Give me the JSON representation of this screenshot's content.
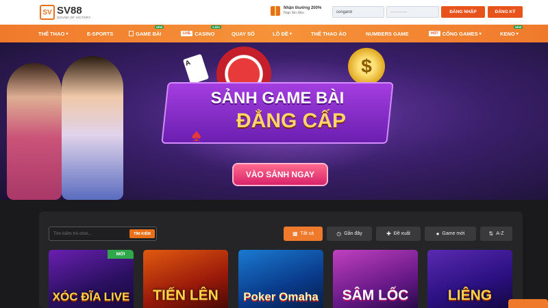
{
  "header": {
    "logo": {
      "mark": "SV",
      "name": "SV88",
      "tagline": "SOUND OF VICTORY"
    },
    "promo": {
      "title": "Nhận thưởng 200%",
      "subtitle": "Nạp lần đầu",
      "icon": "gift-icon"
    },
    "username_value": "congan9",
    "password_value": "············",
    "login_label": "ĐĂNG NHẬP",
    "register_label": "ĐĂNG KÝ"
  },
  "nav": {
    "items": [
      {
        "label": "THỂ THAO",
        "has_dropdown": true
      },
      {
        "label": "E-SPORTS"
      },
      {
        "label": "GAME BÀI",
        "badge": "NEW"
      },
      {
        "label": "CASINO",
        "tag": "LIVE",
        "badge": "0.85%"
      },
      {
        "label": "QUAY SỐ"
      },
      {
        "label": "LÔ ĐỀ",
        "has_dropdown": true
      },
      {
        "label": "THỂ THAO ẢO"
      },
      {
        "label": "NUMBERS GAME"
      },
      {
        "label": "CỔNG GAMES",
        "tag": "HOT",
        "has_dropdown": true
      },
      {
        "label": "KENO",
        "badge": "NEW",
        "has_dropdown": true
      }
    ],
    "chevron": "▾"
  },
  "banner": {
    "line1": "SẢNH GAME BÀI",
    "line2": "ĐẲNG CẤP",
    "cta": "VÀO SẢNH NGAY",
    "card_rank": "A",
    "coin_symbol": "$"
  },
  "lobby": {
    "search_placeholder": "Tìm kiếm trò chơi...",
    "search_button": "TÌM KIẾM",
    "filters": [
      {
        "label": "Tất cả",
        "icon": "grid-icon",
        "glyph": "▦",
        "active": true
      },
      {
        "label": "Gần đây",
        "icon": "clock-icon",
        "glyph": "◷"
      },
      {
        "label": "Đề xuất",
        "icon": "gamepad-icon",
        "glyph": "✚"
      },
      {
        "label": "Game mới",
        "icon": "new-icon",
        "glyph": "●"
      },
      {
        "label": "A-Z",
        "icon": "sort-icon",
        "glyph": "⇅"
      }
    ],
    "games": [
      {
        "title": "XÓC ĐĨA LIVE",
        "badge": "MỚI"
      },
      {
        "title": "TIẾN LÊN"
      },
      {
        "title": "Poker Omaha"
      },
      {
        "title": "SÂM LỐC"
      },
      {
        "title": "LIÊNG"
      }
    ]
  },
  "colors": {
    "accent": "#f07a2c",
    "button": "#e8531c",
    "new_badge": "#2fa84c",
    "panel": "#252527"
  }
}
